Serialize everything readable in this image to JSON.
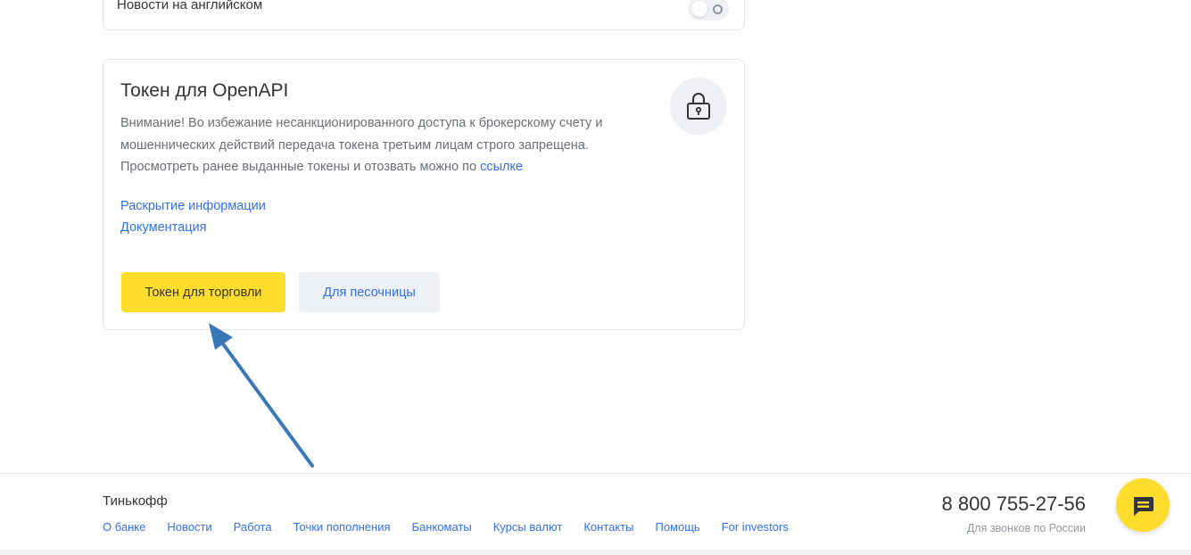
{
  "settings": {
    "english_news_label": "Новости на английском",
    "english_news_enabled": false
  },
  "token_card": {
    "title": "Токен для OpenAPI",
    "warning_line1": "Внимание! Во избежание несанкционированного доступа к брокерскому счету и",
    "warning_line2": "мошеннических действий передача токена третьим лицам строго запрещена.",
    "warning_line3": "Просмотреть ранее выданные токены и отозвать можно по",
    "warning_link": "ссылке",
    "disclosure_link": "Раскрытие информации",
    "docs_link": "Документация",
    "trade_token_button": "Токен для торговли",
    "sandbox_button": "Для песочницы"
  },
  "footer": {
    "brand": "Тинькофф",
    "nav": [
      "О банке",
      "Новости",
      "Работа",
      "Точки пополнения",
      "Банкоматы",
      "Курсы валют",
      "Контакты",
      "Помощь",
      "For investors"
    ],
    "phone": "8 800 755-27-56",
    "phone_note": "Для звонков по России"
  },
  "colors": {
    "accent_yellow": "#ffdd2d",
    "link_blue": "#336fee",
    "arrow_blue": "#3a78b8"
  },
  "icons": {
    "lock": "lock-icon",
    "chat": "chat-icon"
  }
}
